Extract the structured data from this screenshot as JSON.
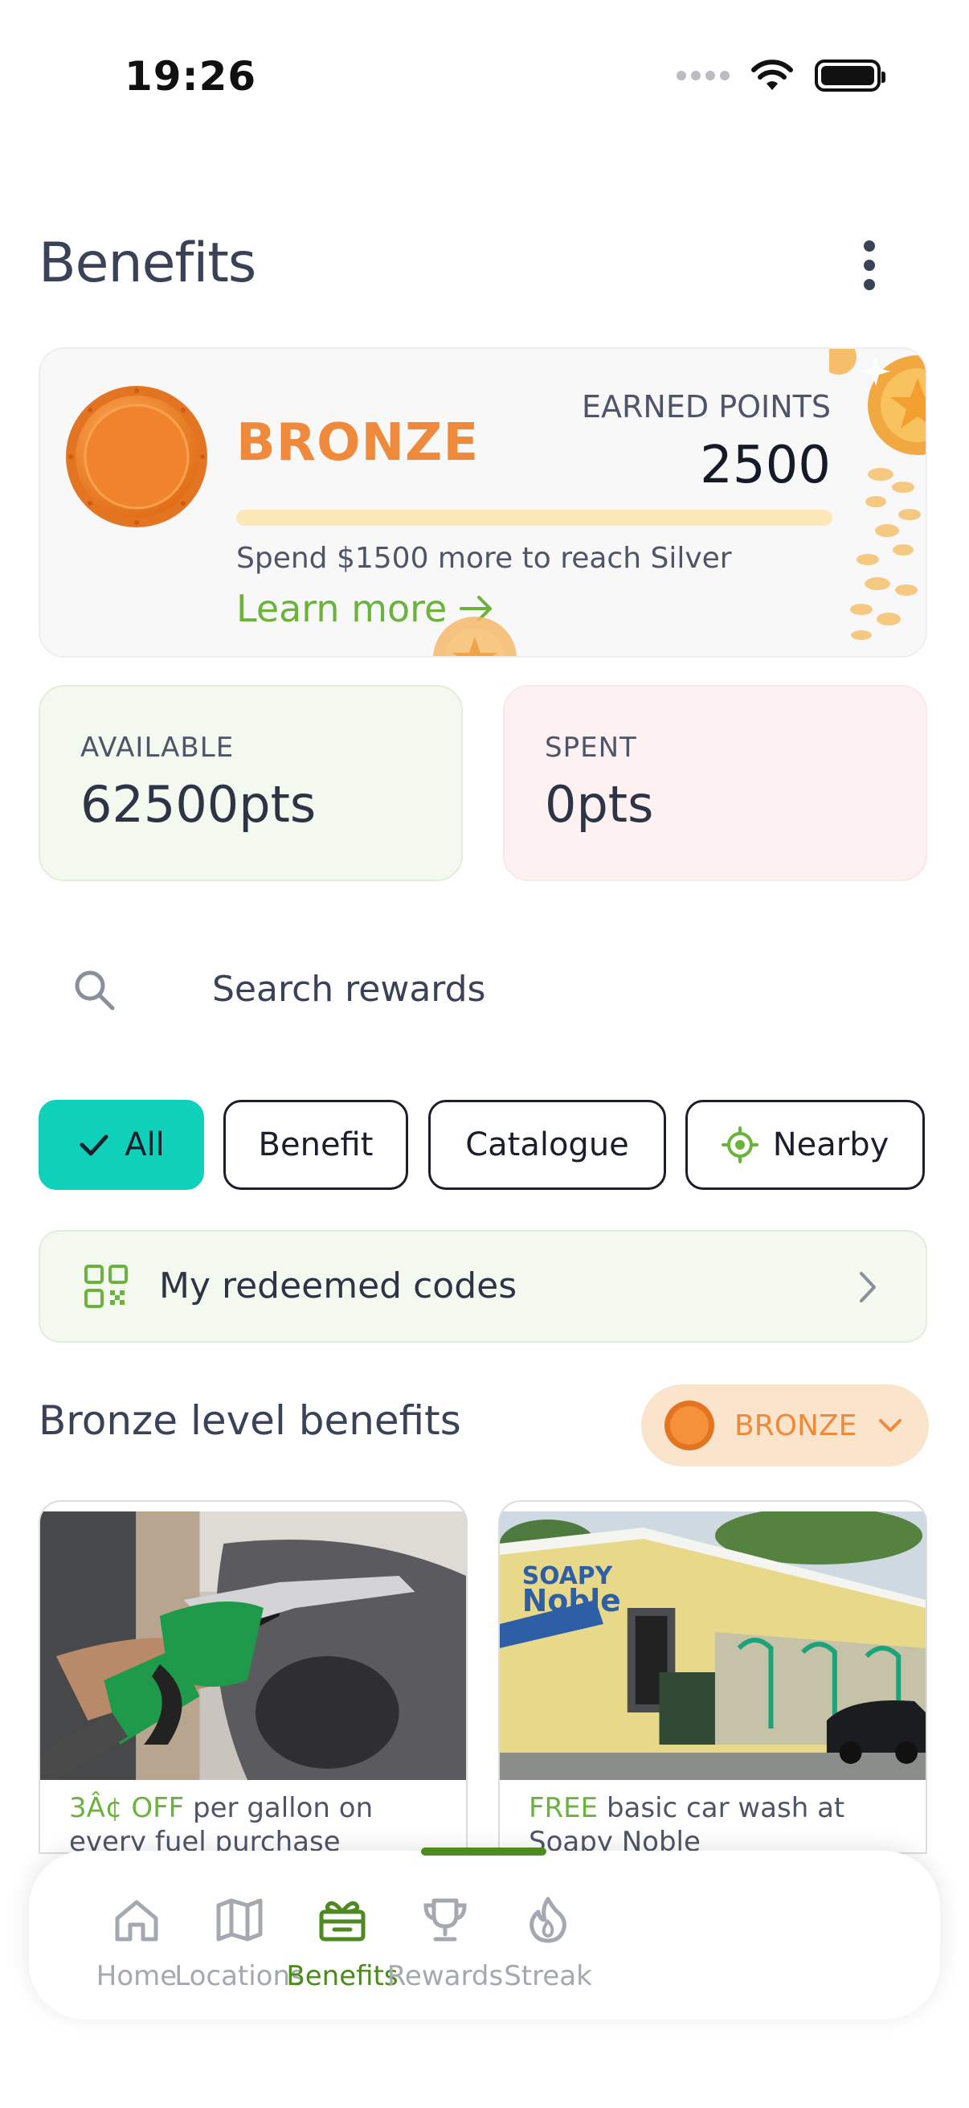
{
  "status_bar": {
    "time": "19:26"
  },
  "header": {
    "title": "Benefits"
  },
  "tier_card": {
    "tier_name": "BRONZE",
    "earned_label": "EARNED POINTS",
    "earned_value": "2500",
    "progress_fraction": 0.0,
    "spend_text": "Spend $1500 more to reach Silver",
    "learn_more": "Learn more"
  },
  "points": {
    "available_label": "AVAILABLE",
    "available_value": "62500pts",
    "spent_label": "SPENT",
    "spent_value": "0pts"
  },
  "search": {
    "placeholder": "Search rewards"
  },
  "filters": {
    "all": "All",
    "benefit": "Benefit",
    "catalogue": "Catalogue",
    "nearby": "Nearby"
  },
  "redeemed": {
    "label": "My redeemed codes"
  },
  "section": {
    "title": "Bronze level benefits",
    "level_selected": "BRONZE"
  },
  "benefits": [
    {
      "highlight": "3Â¢ OFF",
      "text": " per gallon on every fuel purchase"
    },
    {
      "highlight": "FREE",
      "text": " basic car wash at Soapy Noble"
    }
  ],
  "nav": {
    "home": "Home",
    "locations": "Locations",
    "benefits": "Benefits",
    "rewards": "Rewards",
    "streak": "Streak"
  },
  "colors": {
    "bronze": "#ef8a3c",
    "accent_green": "#6bb33c",
    "nav_active": "#4d8a20",
    "chip_selected": "#0fd1b9"
  }
}
